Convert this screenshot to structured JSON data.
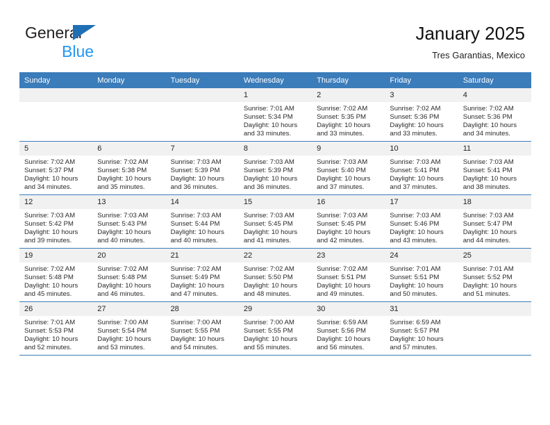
{
  "brand": {
    "word1": "General",
    "word2": "Blue",
    "triangle_color": "#1f6fb4",
    "word2_color": "#2196f3"
  },
  "header": {
    "title": "January 2025",
    "subtitle": "Tres Garantias, Mexico"
  },
  "theme": {
    "header_row_bg": "#3b7cba",
    "header_row_text": "#ffffff",
    "daynum_strip_bg": "#f1f1f1",
    "row_divider": "#3b7cba"
  },
  "weekdays": [
    "Sunday",
    "Monday",
    "Tuesday",
    "Wednesday",
    "Thursday",
    "Friday",
    "Saturday"
  ],
  "weeks": [
    [
      {
        "day": "",
        "blank": true,
        "sunrise": "",
        "sunset": "",
        "daylight_line1": "",
        "daylight_line2": ""
      },
      {
        "day": "",
        "blank": true,
        "sunrise": "",
        "sunset": "",
        "daylight_line1": "",
        "daylight_line2": ""
      },
      {
        "day": "",
        "blank": true,
        "sunrise": "",
        "sunset": "",
        "daylight_line1": "",
        "daylight_line2": ""
      },
      {
        "day": "1",
        "blank": false,
        "sunrise": "Sunrise: 7:01 AM",
        "sunset": "Sunset: 5:34 PM",
        "daylight_line1": "Daylight: 10 hours",
        "daylight_line2": "and 33 minutes."
      },
      {
        "day": "2",
        "blank": false,
        "sunrise": "Sunrise: 7:02 AM",
        "sunset": "Sunset: 5:35 PM",
        "daylight_line1": "Daylight: 10 hours",
        "daylight_line2": "and 33 minutes."
      },
      {
        "day": "3",
        "blank": false,
        "sunrise": "Sunrise: 7:02 AM",
        "sunset": "Sunset: 5:36 PM",
        "daylight_line1": "Daylight: 10 hours",
        "daylight_line2": "and 33 minutes."
      },
      {
        "day": "4",
        "blank": false,
        "sunrise": "Sunrise: 7:02 AM",
        "sunset": "Sunset: 5:36 PM",
        "daylight_line1": "Daylight: 10 hours",
        "daylight_line2": "and 34 minutes."
      }
    ],
    [
      {
        "day": "5",
        "blank": false,
        "sunrise": "Sunrise: 7:02 AM",
        "sunset": "Sunset: 5:37 PM",
        "daylight_line1": "Daylight: 10 hours",
        "daylight_line2": "and 34 minutes."
      },
      {
        "day": "6",
        "blank": false,
        "sunrise": "Sunrise: 7:02 AM",
        "sunset": "Sunset: 5:38 PM",
        "daylight_line1": "Daylight: 10 hours",
        "daylight_line2": "and 35 minutes."
      },
      {
        "day": "7",
        "blank": false,
        "sunrise": "Sunrise: 7:03 AM",
        "sunset": "Sunset: 5:39 PM",
        "daylight_line1": "Daylight: 10 hours",
        "daylight_line2": "and 36 minutes."
      },
      {
        "day": "8",
        "blank": false,
        "sunrise": "Sunrise: 7:03 AM",
        "sunset": "Sunset: 5:39 PM",
        "daylight_line1": "Daylight: 10 hours",
        "daylight_line2": "and 36 minutes."
      },
      {
        "day": "9",
        "blank": false,
        "sunrise": "Sunrise: 7:03 AM",
        "sunset": "Sunset: 5:40 PM",
        "daylight_line1": "Daylight: 10 hours",
        "daylight_line2": "and 37 minutes."
      },
      {
        "day": "10",
        "blank": false,
        "sunrise": "Sunrise: 7:03 AM",
        "sunset": "Sunset: 5:41 PM",
        "daylight_line1": "Daylight: 10 hours",
        "daylight_line2": "and 37 minutes."
      },
      {
        "day": "11",
        "blank": false,
        "sunrise": "Sunrise: 7:03 AM",
        "sunset": "Sunset: 5:41 PM",
        "daylight_line1": "Daylight: 10 hours",
        "daylight_line2": "and 38 minutes."
      }
    ],
    [
      {
        "day": "12",
        "blank": false,
        "sunrise": "Sunrise: 7:03 AM",
        "sunset": "Sunset: 5:42 PM",
        "daylight_line1": "Daylight: 10 hours",
        "daylight_line2": "and 39 minutes."
      },
      {
        "day": "13",
        "blank": false,
        "sunrise": "Sunrise: 7:03 AM",
        "sunset": "Sunset: 5:43 PM",
        "daylight_line1": "Daylight: 10 hours",
        "daylight_line2": "and 40 minutes."
      },
      {
        "day": "14",
        "blank": false,
        "sunrise": "Sunrise: 7:03 AM",
        "sunset": "Sunset: 5:44 PM",
        "daylight_line1": "Daylight: 10 hours",
        "daylight_line2": "and 40 minutes."
      },
      {
        "day": "15",
        "blank": false,
        "sunrise": "Sunrise: 7:03 AM",
        "sunset": "Sunset: 5:45 PM",
        "daylight_line1": "Daylight: 10 hours",
        "daylight_line2": "and 41 minutes."
      },
      {
        "day": "16",
        "blank": false,
        "sunrise": "Sunrise: 7:03 AM",
        "sunset": "Sunset: 5:45 PM",
        "daylight_line1": "Daylight: 10 hours",
        "daylight_line2": "and 42 minutes."
      },
      {
        "day": "17",
        "blank": false,
        "sunrise": "Sunrise: 7:03 AM",
        "sunset": "Sunset: 5:46 PM",
        "daylight_line1": "Daylight: 10 hours",
        "daylight_line2": "and 43 minutes."
      },
      {
        "day": "18",
        "blank": false,
        "sunrise": "Sunrise: 7:03 AM",
        "sunset": "Sunset: 5:47 PM",
        "daylight_line1": "Daylight: 10 hours",
        "daylight_line2": "and 44 minutes."
      }
    ],
    [
      {
        "day": "19",
        "blank": false,
        "sunrise": "Sunrise: 7:02 AM",
        "sunset": "Sunset: 5:48 PM",
        "daylight_line1": "Daylight: 10 hours",
        "daylight_line2": "and 45 minutes."
      },
      {
        "day": "20",
        "blank": false,
        "sunrise": "Sunrise: 7:02 AM",
        "sunset": "Sunset: 5:48 PM",
        "daylight_line1": "Daylight: 10 hours",
        "daylight_line2": "and 46 minutes."
      },
      {
        "day": "21",
        "blank": false,
        "sunrise": "Sunrise: 7:02 AM",
        "sunset": "Sunset: 5:49 PM",
        "daylight_line1": "Daylight: 10 hours",
        "daylight_line2": "and 47 minutes."
      },
      {
        "day": "22",
        "blank": false,
        "sunrise": "Sunrise: 7:02 AM",
        "sunset": "Sunset: 5:50 PM",
        "daylight_line1": "Daylight: 10 hours",
        "daylight_line2": "and 48 minutes."
      },
      {
        "day": "23",
        "blank": false,
        "sunrise": "Sunrise: 7:02 AM",
        "sunset": "Sunset: 5:51 PM",
        "daylight_line1": "Daylight: 10 hours",
        "daylight_line2": "and 49 minutes."
      },
      {
        "day": "24",
        "blank": false,
        "sunrise": "Sunrise: 7:01 AM",
        "sunset": "Sunset: 5:51 PM",
        "daylight_line1": "Daylight: 10 hours",
        "daylight_line2": "and 50 minutes."
      },
      {
        "day": "25",
        "blank": false,
        "sunrise": "Sunrise: 7:01 AM",
        "sunset": "Sunset: 5:52 PM",
        "daylight_line1": "Daylight: 10 hours",
        "daylight_line2": "and 51 minutes."
      }
    ],
    [
      {
        "day": "26",
        "blank": false,
        "sunrise": "Sunrise: 7:01 AM",
        "sunset": "Sunset: 5:53 PM",
        "daylight_line1": "Daylight: 10 hours",
        "daylight_line2": "and 52 minutes."
      },
      {
        "day": "27",
        "blank": false,
        "sunrise": "Sunrise: 7:00 AM",
        "sunset": "Sunset: 5:54 PM",
        "daylight_line1": "Daylight: 10 hours",
        "daylight_line2": "and 53 minutes."
      },
      {
        "day": "28",
        "blank": false,
        "sunrise": "Sunrise: 7:00 AM",
        "sunset": "Sunset: 5:55 PM",
        "daylight_line1": "Daylight: 10 hours",
        "daylight_line2": "and 54 minutes."
      },
      {
        "day": "29",
        "blank": false,
        "sunrise": "Sunrise: 7:00 AM",
        "sunset": "Sunset: 5:55 PM",
        "daylight_line1": "Daylight: 10 hours",
        "daylight_line2": "and 55 minutes."
      },
      {
        "day": "30",
        "blank": false,
        "sunrise": "Sunrise: 6:59 AM",
        "sunset": "Sunset: 5:56 PM",
        "daylight_line1": "Daylight: 10 hours",
        "daylight_line2": "and 56 minutes."
      },
      {
        "day": "31",
        "blank": false,
        "sunrise": "Sunrise: 6:59 AM",
        "sunset": "Sunset: 5:57 PM",
        "daylight_line1": "Daylight: 10 hours",
        "daylight_line2": "and 57 minutes."
      },
      {
        "day": "",
        "blank": true,
        "sunrise": "",
        "sunset": "",
        "daylight_line1": "",
        "daylight_line2": ""
      }
    ]
  ]
}
